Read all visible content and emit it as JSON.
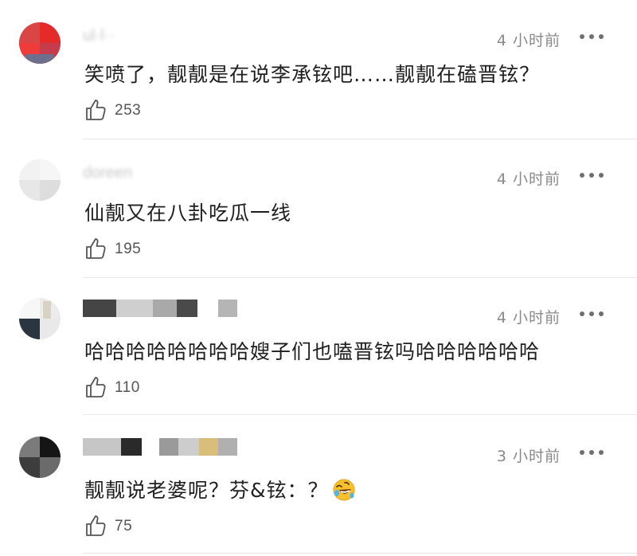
{
  "comments": [
    {
      "time": "4 小时前",
      "text": "笑喷了，靓靓是在说李承铉吧……靓靓在磕晋铉？",
      "likes": "253"
    },
    {
      "time": "4 小时前",
      "text": "仙靓又在八卦吃瓜一线",
      "likes": "195"
    },
    {
      "time": "4 小时前",
      "text": "哈哈哈哈哈哈哈哈嫂子们也嗑晋铉吗哈哈哈哈哈哈",
      "likes": "110"
    },
    {
      "time": "3 小时前",
      "text": "靓靓说老婆呢？芬&铉：？",
      "emoji": "rolling-on-floor-laughing",
      "likes": "75"
    }
  ],
  "colors": {
    "text": "#1f1f1f",
    "meta": "#8a8a8a",
    "divider": "#e8e8e8",
    "icon": "#555555"
  }
}
